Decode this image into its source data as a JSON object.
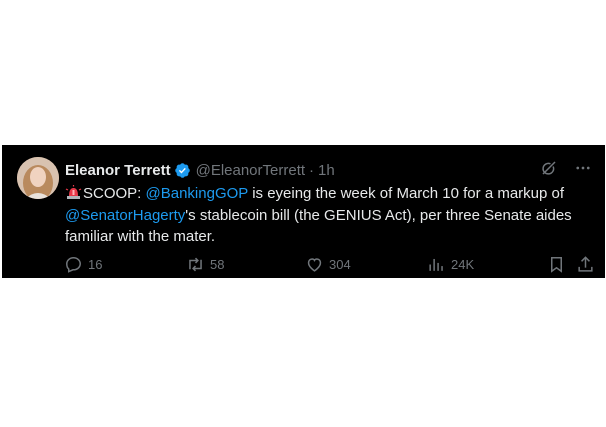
{
  "tweet": {
    "author_name": "Eleanor Terrett",
    "handle": "@EleanorTerrett",
    "separator": "·",
    "time": "1h",
    "body": {
      "emoji": "siren-emoji",
      "prefix": "SCOOP: ",
      "mention1": "@BankingGOP",
      "text1": " is eyeing the week of March 10 for a markup of ",
      "mention2": "@SenatorHagerty",
      "text2": "'s stablecoin bill (the GENIUS Act), per three Senate aides familiar with the mater."
    },
    "actions": {
      "replies": "16",
      "reposts": "58",
      "likes": "304",
      "views": "24K"
    }
  },
  "colors": {
    "background": "#000000",
    "text": "#e7e9ea",
    "muted": "#71767b",
    "link": "#1d9bf0"
  }
}
